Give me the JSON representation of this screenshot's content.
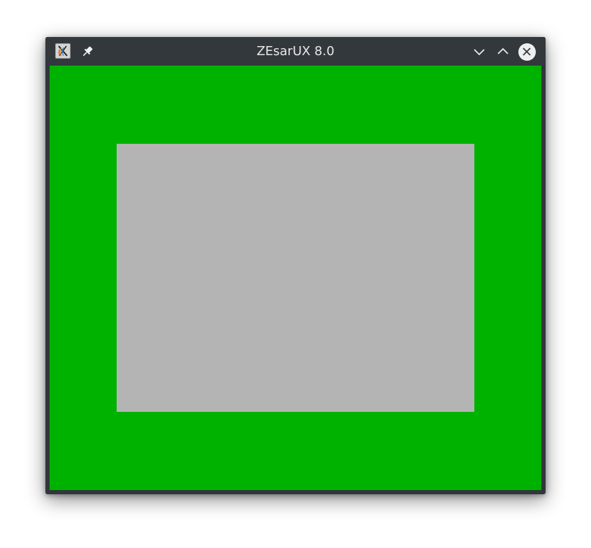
{
  "window": {
    "title": "ZEsarUX 8.0",
    "icons": {
      "app": "zesarux-app-icon",
      "pin": "pin-icon",
      "minimize": "chevron-down-icon",
      "maximize": "chevron-up-icon",
      "close": "close-icon"
    }
  },
  "emulator_screen": {
    "border_color": "#00b200",
    "paper_color": "#b4b4b4"
  }
}
